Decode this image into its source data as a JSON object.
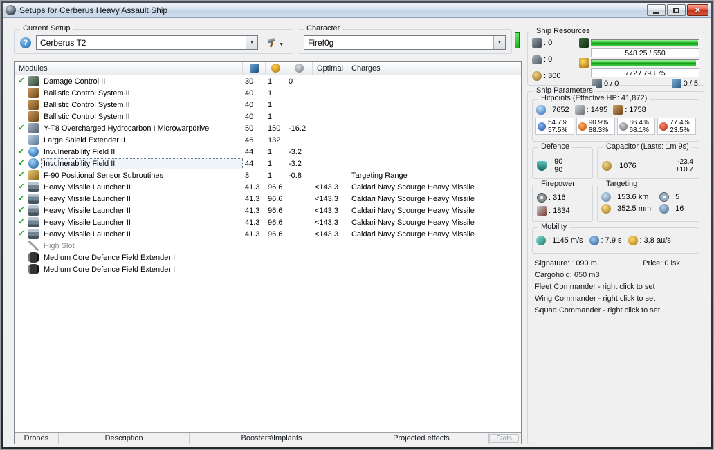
{
  "window": {
    "title": "Setups for Cerberus Heavy Assault Ship"
  },
  "setup": {
    "label": "Current Setup",
    "value": "Cerberus T2"
  },
  "character": {
    "label": "Character",
    "value": "Firef0g"
  },
  "modules": {
    "header": {
      "name": "Modules",
      "optimal": "Optimal",
      "charges": "Charges"
    },
    "rows": [
      {
        "check": "✓",
        "icon": "mod-icon icon-dcu",
        "name": "Damage Control II",
        "cpu": "30",
        "pg": "1",
        "cap": "0",
        "optimal": "",
        "charge": ""
      },
      {
        "check": "",
        "icon": "mod-icon icon-bcs",
        "name": "Ballistic Control System II",
        "cpu": "40",
        "pg": "1",
        "cap": "",
        "optimal": "",
        "charge": ""
      },
      {
        "check": "",
        "icon": "mod-icon icon-bcs",
        "name": "Ballistic Control System II",
        "cpu": "40",
        "pg": "1",
        "cap": "",
        "optimal": "",
        "charge": ""
      },
      {
        "check": "",
        "icon": "mod-icon icon-bcs",
        "name": "Ballistic Control System II",
        "cpu": "40",
        "pg": "1",
        "cap": "",
        "optimal": "",
        "charge": ""
      },
      {
        "check": "✓",
        "icon": "mod-icon icon-mwd",
        "name": "Y-T8 Overcharged Hydrocarbon I Microwarpdrive",
        "cpu": "50",
        "pg": "150",
        "cap": "-16.2",
        "optimal": "",
        "charge": ""
      },
      {
        "check": "",
        "icon": "mod-icon icon-lse",
        "name": "Large Shield Extender II",
        "cpu": "46",
        "pg": "132",
        "cap": "",
        "optimal": "",
        "charge": ""
      },
      {
        "check": "✓",
        "icon": "mod-icon icon-invuln",
        "name": "Invulnerability Field II",
        "cpu": "44",
        "pg": "1",
        "cap": "-3.2",
        "optimal": "",
        "charge": ""
      },
      {
        "check": "✓",
        "icon": "mod-icon icon-invuln",
        "name": "Invulnerability Field II",
        "cpu": "44",
        "pg": "1",
        "cap": "-3.2",
        "optimal": "",
        "charge": ""
      },
      {
        "check": "✓",
        "icon": "mod-icon icon-sensor",
        "name": "F-90 Positional Sensor Subroutines",
        "cpu": "8",
        "pg": "1",
        "cap": "-0.8",
        "optimal": "",
        "charge": "Targeting Range"
      },
      {
        "check": "✓",
        "icon": "mod-icon icon-launcher",
        "name": "Heavy Missile Launcher II",
        "cpu": "41.3",
        "pg": "96.6",
        "cap": "",
        "optimal": "<143.3",
        "charge": "Caldari Navy Scourge Heavy Missile"
      },
      {
        "check": "✓",
        "icon": "mod-icon icon-launcher",
        "name": "Heavy Missile Launcher II",
        "cpu": "41.3",
        "pg": "96.6",
        "cap": "",
        "optimal": "<143.3",
        "charge": "Caldari Navy Scourge Heavy Missile"
      },
      {
        "check": "✓",
        "icon": "mod-icon icon-launcher",
        "name": "Heavy Missile Launcher II",
        "cpu": "41.3",
        "pg": "96.6",
        "cap": "",
        "optimal": "<143.3",
        "charge": "Caldari Navy Scourge Heavy Missile"
      },
      {
        "check": "✓",
        "icon": "mod-icon icon-launcher",
        "name": "Heavy Missile Launcher II",
        "cpu": "41.3",
        "pg": "96.6",
        "cap": "",
        "optimal": "<143.3",
        "charge": "Caldari Navy Scourge Heavy Missile"
      },
      {
        "check": "✓",
        "icon": "mod-icon icon-launcher",
        "name": "Heavy Missile Launcher II",
        "cpu": "41.3",
        "pg": "96.6",
        "cap": "",
        "optimal": "<143.3",
        "charge": "Caldari Navy Scourge Heavy Missile"
      },
      {
        "check": "",
        "icon": "mod-icon icon-empty",
        "name": "High Slot",
        "cpu": "",
        "pg": "",
        "cap": "",
        "optimal": "",
        "charge": ""
      },
      {
        "check": "",
        "icon": "mod-icon icon-rig",
        "name": "Medium Core Defence Field Extender I",
        "cpu": "",
        "pg": "",
        "cap": "",
        "optimal": "",
        "charge": ""
      },
      {
        "check": "",
        "icon": "mod-icon icon-rig",
        "name": "Medium Core Defence Field Extender I",
        "cpu": "",
        "pg": "",
        "cap": "",
        "optimal": "",
        "charge": ""
      }
    ]
  },
  "tabs": {
    "drones": "Drones",
    "description": "Description",
    "boosters": "Boosters\\Implants",
    "projected": "Projected effects",
    "stats": "Stats"
  },
  "resources": {
    "label": "Ship Resources",
    "turrets": ": 0",
    "launchers": ": 0",
    "calibration": ": 300",
    "cpu": "548.25 / 550",
    "powergrid": "772 / 793.75",
    "drones": "0 / 0",
    "bandwidth": "0 / 5"
  },
  "params": {
    "label": "Ship Parameters",
    "hitpoints": {
      "label": "Hitpoints (Effective HP: 41,872)",
      "shield": ": 7652",
      "armor": ": 1495",
      "structure": ": 1758",
      "resists": [
        {
          "shield": "54.7%",
          "armor": "57.5%"
        },
        {
          "shield": "90.9%",
          "armor": "88.3%"
        },
        {
          "shield": "86.4%",
          "armor": "68.1%"
        },
        {
          "shield": "77.4%",
          "armor": "23.5%"
        }
      ]
    },
    "defence": {
      "label": "Defence",
      "top": ": 90",
      "bottom": ": 90"
    },
    "capacitor": {
      "label": "Capacitor (Lasts: 1m 9s)",
      "amount": ": 1076",
      "drain": "-23.4",
      "recharge": "+10.7"
    },
    "firepower": {
      "label": "Firepower",
      "dps": ": 316",
      "volley": ": 1834"
    },
    "targeting": {
      "label": "Targeting",
      "range": ": 153.6 km",
      "max_targets": ": 5",
      "scan_resolution": ": 352.5 mm",
      "sensor_strength": ": 16"
    },
    "mobility": {
      "label": "Mobility",
      "speed": ": 1145 m/s",
      "align_time": ": 7.9 s",
      "warp_speed": ": 3.8 au/s"
    },
    "signature": "Signature: 1090 m",
    "price": "Price: 0 isk",
    "cargohold": "Cargohold: 650 m3",
    "fleet_commander": "Fleet Commander - right click to set",
    "wing_commander": "Wing Commander - right click to set",
    "squad_commander": "Squad Commander - right click to set"
  }
}
